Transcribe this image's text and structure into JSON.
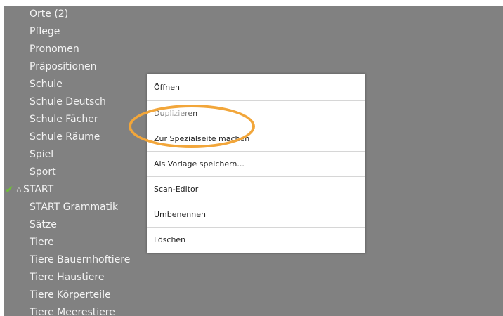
{
  "list": {
    "items": [
      {
        "label": "Orte (2)"
      },
      {
        "label": "Pflege"
      },
      {
        "label": "Pronomen"
      },
      {
        "label": "Präpositionen"
      },
      {
        "label": "Schule"
      },
      {
        "label": "Schule Deutsch"
      },
      {
        "label": "Schule Fächer"
      },
      {
        "label": "Schule Räume"
      },
      {
        "label": "Spiel"
      },
      {
        "label": "Sport"
      },
      {
        "label": "START",
        "check_icon": "✔",
        "home_icon": "⌂"
      },
      {
        "label": "START Grammatik"
      },
      {
        "label": "Sätze"
      },
      {
        "label": "Tiere"
      },
      {
        "label": "Tiere Bauernhoftiere"
      },
      {
        "label": "Tiere Haustiere"
      },
      {
        "label": "Tiere Körperteile"
      },
      {
        "label": "Tiere Meerestiere"
      }
    ]
  },
  "context_menu": {
    "items": [
      {
        "label": "Öffnen"
      },
      {
        "label": "Duplizieren"
      },
      {
        "label": "Zur Spezialseite machen"
      },
      {
        "label": "Als Vorlage speichern..."
      },
      {
        "label": "Scan-Editor"
      },
      {
        "label": "Umbenennen"
      },
      {
        "label": "Löschen"
      }
    ]
  },
  "colors": {
    "backdrop": "#818181",
    "highlight": "#f2a63a",
    "check": "#6fbf3a"
  }
}
